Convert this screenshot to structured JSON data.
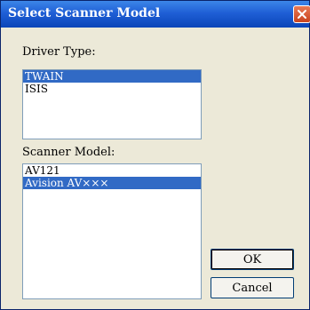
{
  "window": {
    "title": "Select Scanner Model",
    "close_icon": "close-icon"
  },
  "driver_type": {
    "label": "Driver Type:",
    "items": [
      "TWAIN",
      "ISIS"
    ],
    "selected": "TWAIN"
  },
  "scanner_model": {
    "label": "Scanner Model:",
    "items": [
      "AV121",
      "Avision AV×××"
    ],
    "selected": "Avision AV×××"
  },
  "buttons": {
    "ok": "OK",
    "cancel": "Cancel"
  },
  "colors": {
    "title_bar": "#1f5fd6",
    "selection": "#316ac5",
    "dialog_bg": "#ece9d8",
    "close_button": "#c8431e"
  }
}
